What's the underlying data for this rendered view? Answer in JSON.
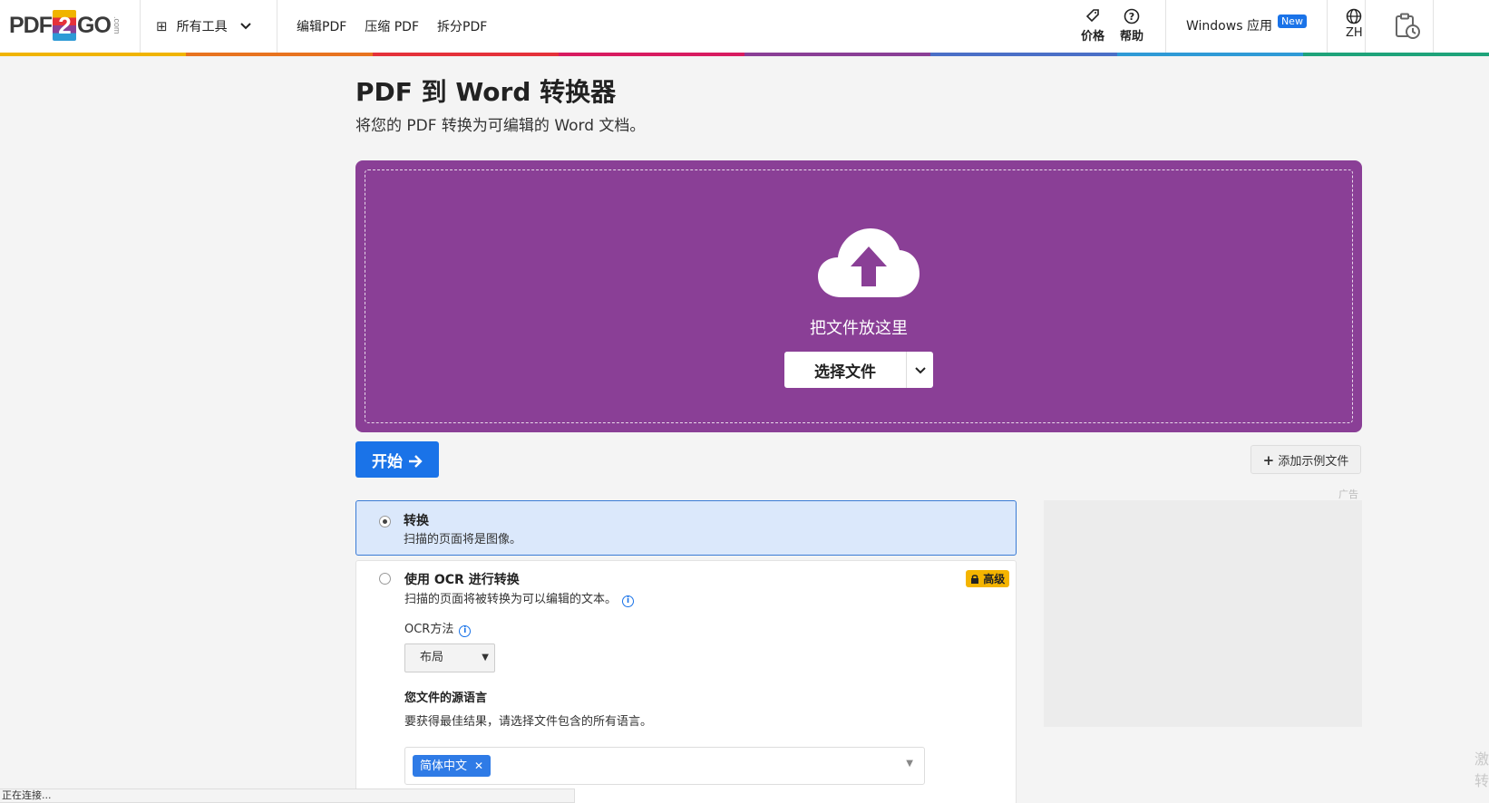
{
  "header": {
    "logo_left": "PDF",
    "logo_mid": "2",
    "logo_right": "GO",
    "logo_suffix": ".com",
    "all_tools": "所有工具",
    "nav": [
      "编辑PDF",
      "压缩 PDF",
      "拆分PDF"
    ],
    "pricing": "价格",
    "help": "帮助",
    "windows_app": "Windows 应用",
    "new_badge": "New",
    "language": "ZH"
  },
  "rainbow_colors": [
    "#f0b400",
    "#e8731f",
    "#e5313a",
    "#d81b60",
    "#8a3f96",
    "#4a6fc7",
    "#2e9ad6",
    "#1ea37a"
  ],
  "page": {
    "title": "PDF 到 Word 转换器",
    "subtitle": "将您的 PDF 转换为可编辑的 Word 文档。"
  },
  "upload": {
    "drop_text": "把文件放这里",
    "choose_file": "选择文件",
    "accent_color": "#8a3f96"
  },
  "actions": {
    "start": "开始",
    "add_sample": "添加示例文件"
  },
  "options": {
    "convert": {
      "title": "转换",
      "desc": "扫描的页面将是图像。",
      "selected": true
    },
    "ocr": {
      "title": "使用 OCR 进行转换",
      "desc": "扫描的页面将被转换为可以编辑的文本。",
      "premium": "高级",
      "method_label": "OCR方法",
      "method_value": "布局",
      "lang_label": "您文件的源语言",
      "lang_hint": "要获得最佳结果，请选择文件包含的所有语言。",
      "lang_selected": "简体中文"
    }
  },
  "ad": {
    "label": "广告"
  },
  "status": "正在连接...",
  "side_text": "激转"
}
